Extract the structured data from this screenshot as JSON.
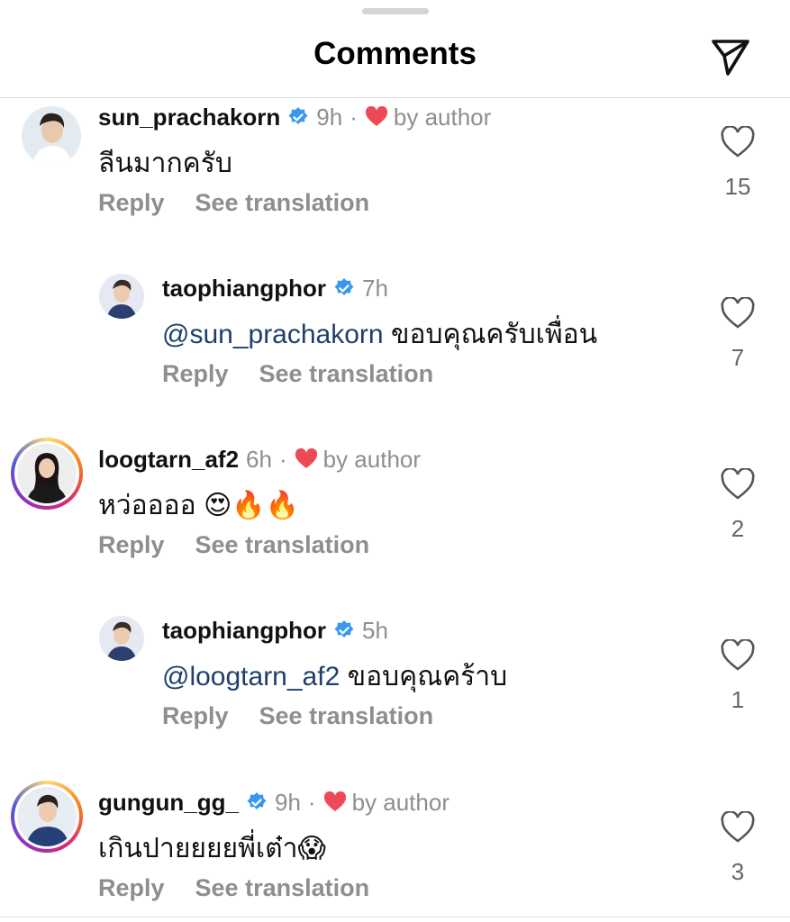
{
  "header": {
    "title": "Comments",
    "share_icon": "send-icon"
  },
  "colors": {
    "verified": "#3897f0",
    "heart": "#ed4956",
    "muted": "#8e8e8e",
    "mention": "#1f3f6b"
  },
  "comments": [
    {
      "username": "sun_prachakorn",
      "verified": true,
      "time": "9h",
      "dot": "·",
      "liked_by_author": "by author",
      "mention": "",
      "text": "ลีนมากครับ",
      "emoji": "",
      "reply": "Reply",
      "translate": "See translation",
      "likes": "15"
    },
    {
      "username": "taophiangphor",
      "verified": true,
      "time": "7h",
      "dot": "",
      "liked_by_author": "",
      "mention": "@sun_prachakorn",
      "text": " ขอบคุณครับเพื่อน",
      "emoji": "",
      "reply": "Reply",
      "translate": "See translation",
      "likes": "7"
    },
    {
      "username": "loogtarn_af2",
      "verified": false,
      "time": "6h",
      "dot": "·",
      "liked_by_author": "by author",
      "mention": "",
      "text": "หว่ออออ ",
      "emoji": "😍🔥🔥",
      "reply": "Reply",
      "translate": "See translation",
      "likes": "2"
    },
    {
      "username": "taophiangphor",
      "verified": true,
      "time": "5h",
      "dot": "",
      "liked_by_author": "",
      "mention": "@loogtarn_af2",
      "text": " ขอบคุณคร้าบ",
      "emoji": "",
      "reply": "Reply",
      "translate": "See translation",
      "likes": "1"
    },
    {
      "username": "gungun_gg_",
      "verified": true,
      "time": "9h",
      "dot": "·",
      "liked_by_author": "by author",
      "mention": "",
      "text": "เกินปายยยยพี่เต๋า",
      "emoji": "😱",
      "reply": "Reply",
      "translate": "See translation",
      "likes": "3"
    }
  ]
}
